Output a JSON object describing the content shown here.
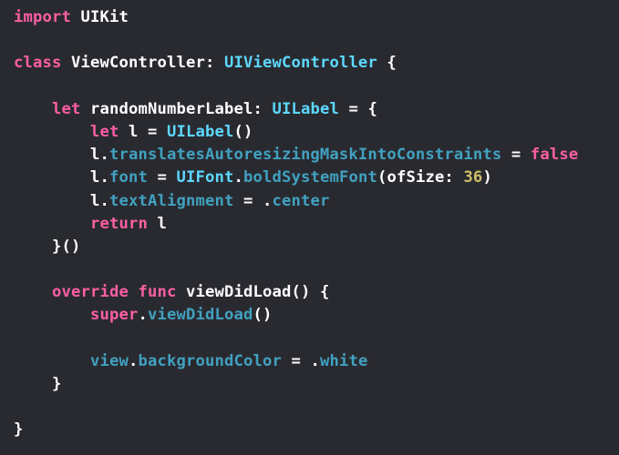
{
  "editor": {
    "background": "#292a30",
    "colors": {
      "keyword": "#fc5fa3",
      "type": "#5dd8ff",
      "property": "#41a1c0",
      "number": "#d0bf69",
      "plain": "#ffffff"
    },
    "lines": [
      [
        {
          "t": "kw",
          "s": "import"
        },
        {
          "t": "plain",
          "s": " UIKit"
        }
      ],
      [],
      [
        {
          "t": "kw",
          "s": "class"
        },
        {
          "t": "plain",
          "s": " ViewController: "
        },
        {
          "t": "type",
          "s": "UIViewController"
        },
        {
          "t": "plain",
          "s": " {"
        }
      ],
      [],
      [
        {
          "t": "plain",
          "s": "    "
        },
        {
          "t": "kw",
          "s": "let"
        },
        {
          "t": "plain",
          "s": " randomNumberLabel: "
        },
        {
          "t": "type",
          "s": "UILabel"
        },
        {
          "t": "plain",
          "s": " = {"
        }
      ],
      [
        {
          "t": "plain",
          "s": "        "
        },
        {
          "t": "kw",
          "s": "let"
        },
        {
          "t": "plain",
          "s": " l = "
        },
        {
          "t": "type",
          "s": "UILabel"
        },
        {
          "t": "plain",
          "s": "()"
        }
      ],
      [
        {
          "t": "plain",
          "s": "        l."
        },
        {
          "t": "prop",
          "s": "translatesAutoresizingMaskIntoConstraints"
        },
        {
          "t": "plain",
          "s": " = "
        },
        {
          "t": "kw",
          "s": "false"
        }
      ],
      [
        {
          "t": "plain",
          "s": "        l."
        },
        {
          "t": "prop",
          "s": "font"
        },
        {
          "t": "plain",
          "s": " = "
        },
        {
          "t": "type",
          "s": "UIFont"
        },
        {
          "t": "plain",
          "s": "."
        },
        {
          "t": "prop",
          "s": "boldSystemFont"
        },
        {
          "t": "plain",
          "s": "(ofSize: "
        },
        {
          "t": "num",
          "s": "36"
        },
        {
          "t": "plain",
          "s": ")"
        }
      ],
      [
        {
          "t": "plain",
          "s": "        l."
        },
        {
          "t": "prop",
          "s": "textAlignment"
        },
        {
          "t": "plain",
          "s": " = ."
        },
        {
          "t": "prop",
          "s": "center"
        }
      ],
      [
        {
          "t": "plain",
          "s": "        "
        },
        {
          "t": "kw",
          "s": "return"
        },
        {
          "t": "plain",
          "s": " l"
        }
      ],
      [
        {
          "t": "plain",
          "s": "    }()"
        }
      ],
      [],
      [
        {
          "t": "plain",
          "s": "    "
        },
        {
          "t": "kw",
          "s": "override"
        },
        {
          "t": "plain",
          "s": " "
        },
        {
          "t": "kw",
          "s": "func"
        },
        {
          "t": "plain",
          "s": " viewDidLoad() {"
        }
      ],
      [
        {
          "t": "plain",
          "s": "        "
        },
        {
          "t": "kw",
          "s": "super"
        },
        {
          "t": "plain",
          "s": "."
        },
        {
          "t": "prop",
          "s": "viewDidLoad"
        },
        {
          "t": "plain",
          "s": "()"
        }
      ],
      [],
      [
        {
          "t": "plain",
          "s": "        "
        },
        {
          "t": "prop",
          "s": "view"
        },
        {
          "t": "plain",
          "s": "."
        },
        {
          "t": "prop",
          "s": "backgroundColor"
        },
        {
          "t": "plain",
          "s": " = ."
        },
        {
          "t": "prop",
          "s": "white"
        }
      ],
      [
        {
          "t": "plain",
          "s": "    }"
        }
      ],
      [],
      [
        {
          "t": "plain",
          "s": "}"
        }
      ]
    ]
  }
}
